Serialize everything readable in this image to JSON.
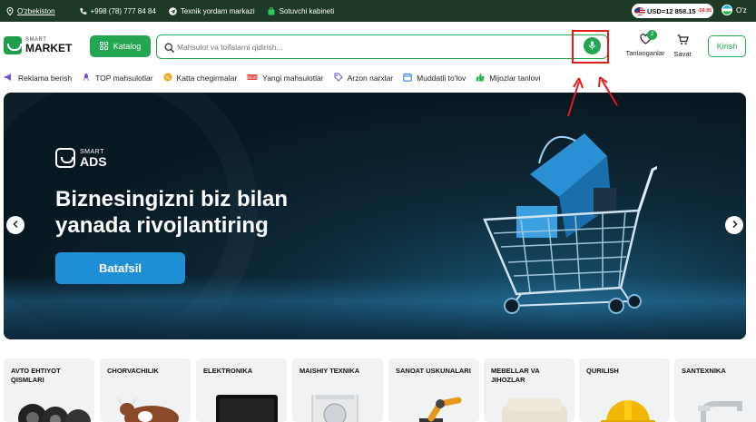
{
  "topbar": {
    "region": "O'zbekiston",
    "phone": "+998 (78) 777 84 84",
    "support": "Texnik yordam markazi",
    "seller": "Sotuvchi kabineti",
    "currency": "USD=12 858.15",
    "currency_change": "-58.95",
    "language": "O'z"
  },
  "header": {
    "logo_small": "SMART",
    "logo_big": "MARKET",
    "catalog_label": "Katalog",
    "search_placeholder": "Mahsulot va toifalarni qidirish...",
    "favorites_label": "Tanlanganlar",
    "favorites_count": "2",
    "cart_label": "Savat",
    "login_label": "Kirish"
  },
  "nav": {
    "items": [
      {
        "label": "Reklama berish",
        "color": "#7b4fd6"
      },
      {
        "label": "TOP mahsulotlar",
        "color": "#7b4fd6"
      },
      {
        "label": "Katta chegirmalar",
        "color": "#e8a317"
      },
      {
        "label": "Yangi mahsulotlar",
        "color": "#e23b3b"
      },
      {
        "label": "Arzon narxlar",
        "color": "#6a6ee0"
      },
      {
        "label": "Muddatli to'lov",
        "color": "#3a7de0"
      },
      {
        "label": "Mijozlar tanlovi",
        "color": "#2eb34f"
      }
    ]
  },
  "hero": {
    "brand_small": "SMART",
    "brand_big": "ADS",
    "title": "Biznesingizni biz bilan yanada rivojlantiring",
    "button": "Batafsil"
  },
  "categories": [
    {
      "label": "AVTO EHTIYOT QISMLARI"
    },
    {
      "label": "CHORVACHILIK"
    },
    {
      "label": "ELEKTRONIKA"
    },
    {
      "label": "MAISHIY TEXNIKA"
    },
    {
      "label": "SANOAT USKUNALARI"
    },
    {
      "label": "MEBELLAR VA JIHOZLAR"
    },
    {
      "label": "QURILISH"
    },
    {
      "label": "SANTEXNIKA"
    }
  ],
  "colors": {
    "brand_green": "#22a650",
    "topbar": "#1d3a26",
    "highlight": "#e31b1b"
  }
}
